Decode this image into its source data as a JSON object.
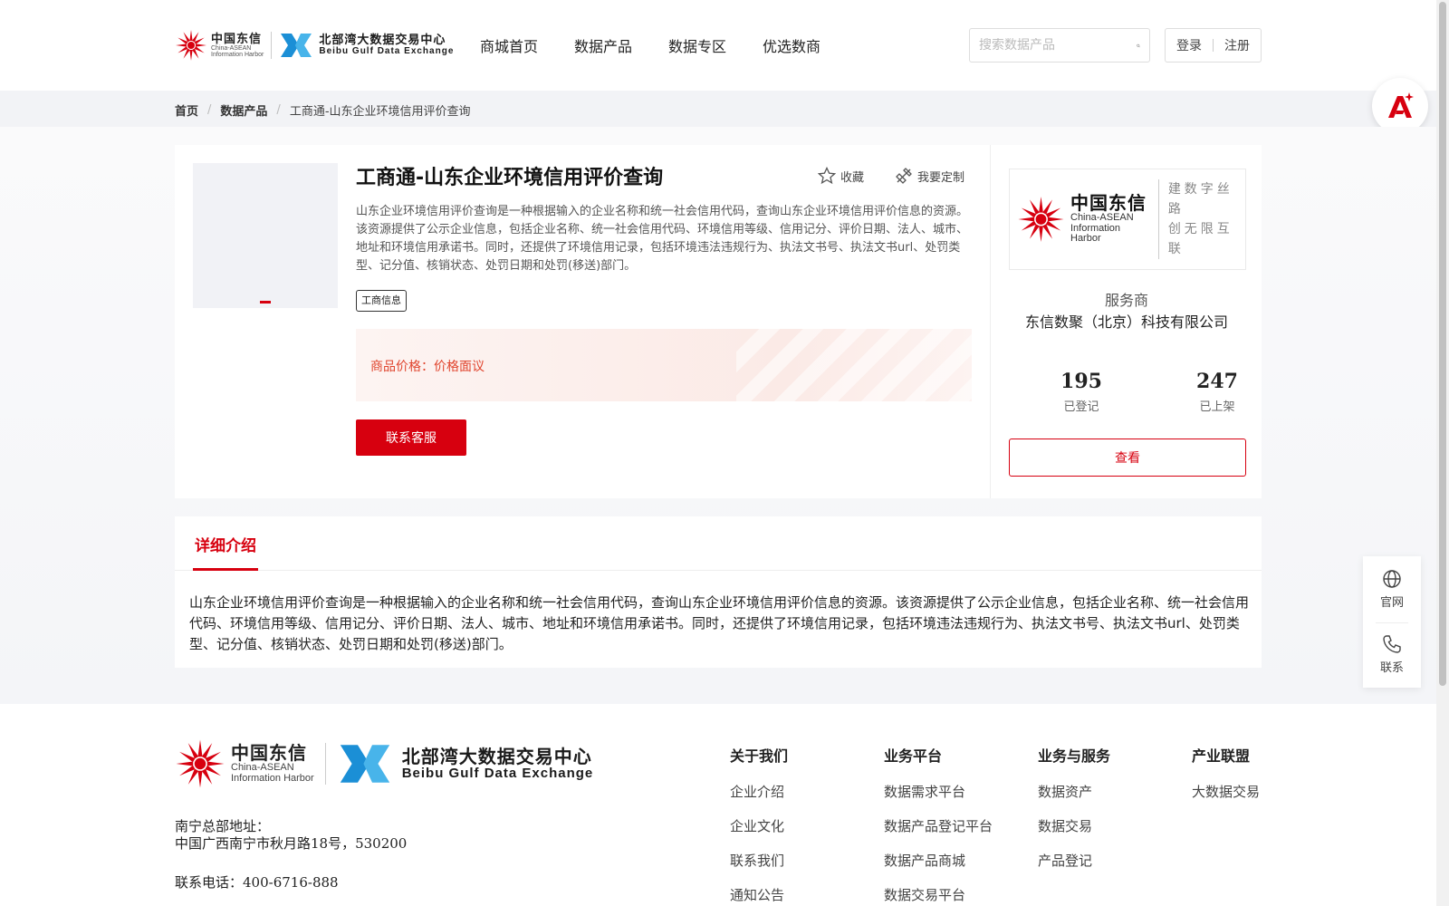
{
  "header": {
    "logo_cn": "中国东信",
    "logo_en1": "China-ASEAN",
    "logo_en2": "Information Harbor",
    "bbx_cn": "北部湾大数据交易中心",
    "bbx_en": "Beibu Gulf Data Exchange",
    "nav": [
      "商城首页",
      "数据产品",
      "数据专区",
      "优选数商"
    ],
    "search_placeholder": "搜索数据产品",
    "login": "登录",
    "register": "注册"
  },
  "breadcrumb": [
    "首页",
    "数据产品",
    "工商通-山东企业环境信用评价查询"
  ],
  "product": {
    "title": "工商通-山东企业环境信用评价查询",
    "favorite": "收藏",
    "customize": "我要定制",
    "description": "山东企业环境信用评价查询是一种根据输入的企业名称和统一社会信用代码，查询山东企业环境信用评价信息的资源。该资源提供了公示企业信息，包括企业名称、统一社会信用代码、环境信用等级、信用记分、评价日期、法人、城市、地址和环境信用承诺书。同时，还提供了环境信用记录，包括环境违法违规行为、执法文书号、执法文书url、处罚类型、记分值、核销状态、处罚日期和处罚(移送)部门。",
    "tag": "工商信息",
    "price_label": "商品价格：",
    "price_value": "价格面议",
    "contact_button": "联系客服"
  },
  "provider": {
    "logo_cn": "中国东信",
    "logo_en1": "China-ASEAN",
    "logo_en2": "Information Harbor",
    "slogan1": "建数字丝路",
    "slogan2": "创无限互联",
    "type": "服务商",
    "name": "东信数聚（北京）科技有限公司",
    "stats": [
      {
        "value": "195",
        "label": "已登记"
      },
      {
        "value": "247",
        "label": "已上架"
      }
    ],
    "view_button": "查看"
  },
  "detail": {
    "tab": "详细介绍",
    "body": "山东企业环境信用评价查询是一种根据输入的企业名称和统一社会信用代码，查询山东企业环境信用评价信息的资源。该资源提供了公示企业信息，包括企业名称、统一社会信用代码、环境信用等级、信用记分、评价日期、法人、城市、地址和环境信用承诺书。同时，还提供了环境信用记录，包括环境违法违规行为、执法文书号、执法文书url、处罚类型、记分值、核销状态、处罚日期和处罚(移送)部门。"
  },
  "sidetools": {
    "website": "官网",
    "contact": "联系"
  },
  "footer": {
    "address_label": "南宁总部地址：",
    "address": "中国广西南宁市秋月路18号，530200",
    "phone": "联系电话：400-6716-888",
    "columns": [
      {
        "title": "关于我们",
        "links": [
          "企业介绍",
          "企业文化",
          "联系我们",
          "通知公告"
        ]
      },
      {
        "title": "业务平台",
        "links": [
          "数据需求平台",
          "数据产品登记平台",
          "数据产品商城",
          "数据交易平台"
        ]
      },
      {
        "title": "业务与服务",
        "links": [
          "数据资产",
          "数据交易",
          "产品登记"
        ]
      },
      {
        "title": "产业联盟",
        "links": [
          "大数据交易"
        ]
      }
    ]
  },
  "colors": {
    "brand_red": "#d7000f",
    "price_red": "#e0442d",
    "bbx_blue": "#1b8fd6"
  }
}
